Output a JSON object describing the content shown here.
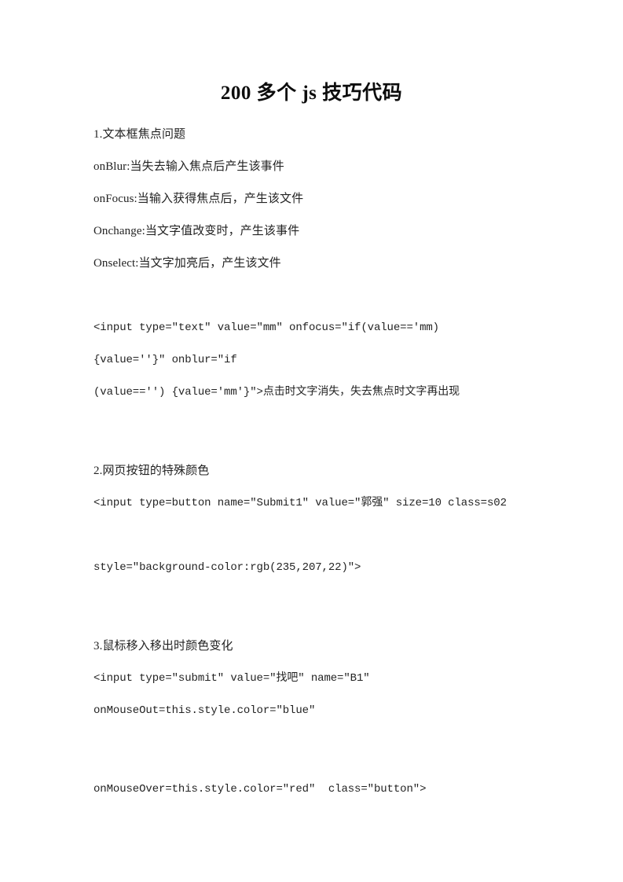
{
  "document": {
    "title": "200 多个 js 技巧代码",
    "background_color": "#ffffff",
    "text_color": "#232323"
  },
  "content": {
    "lines": [
      {
        "id": "l1",
        "text": "1.文本框焦点问题",
        "kind": "heading"
      },
      {
        "id": "l2",
        "text": "onBlur:当失去输入焦点后产生该事件",
        "kind": "body"
      },
      {
        "id": "l3",
        "text": "onFocus:当输入获得焦点后，产生该文件",
        "kind": "body"
      },
      {
        "id": "l4",
        "text": "Onchange:当文字值改变时，产生该事件",
        "kind": "body"
      },
      {
        "id": "l5",
        "text": "Onselect:当文字加亮后，产生该文件",
        "kind": "body"
      },
      {
        "id": "l6",
        "text": "<input type=\"text\" value=\"mm\" onfocus=\"if(value=='mm)",
        "kind": "code"
      },
      {
        "id": "l7",
        "text": "{value=''}\" onblur=\"if",
        "kind": "code"
      },
      {
        "id": "l8",
        "text": "(value=='') {value='mm'}\">点击时文字消失，失去焦点时文字再出现",
        "kind": "code"
      },
      {
        "id": "l9",
        "text": "2.网页按钮的特殊颜色",
        "kind": "heading"
      },
      {
        "id": "l10",
        "text": "<input type=button name=\"Submit1\" value=\"郭强\" size=10 class=s02",
        "kind": "code"
      },
      {
        "id": "l11",
        "text": "style=\"background-color:rgb(235,207,22)\">",
        "kind": "code"
      },
      {
        "id": "l12",
        "text": "3.鼠标移入移出时颜色变化",
        "kind": "heading"
      },
      {
        "id": "l13",
        "text": "<input type=\"submit\" value=\"找吧\" name=\"B1\"",
        "kind": "code"
      },
      {
        "id": "l14",
        "text": "onMouseOut=this.style.color=\"blue\"",
        "kind": "code"
      },
      {
        "id": "l15",
        "text": "onMouseOver=this.style.color=\"red\"  class=\"button\">",
        "kind": "code"
      }
    ]
  }
}
